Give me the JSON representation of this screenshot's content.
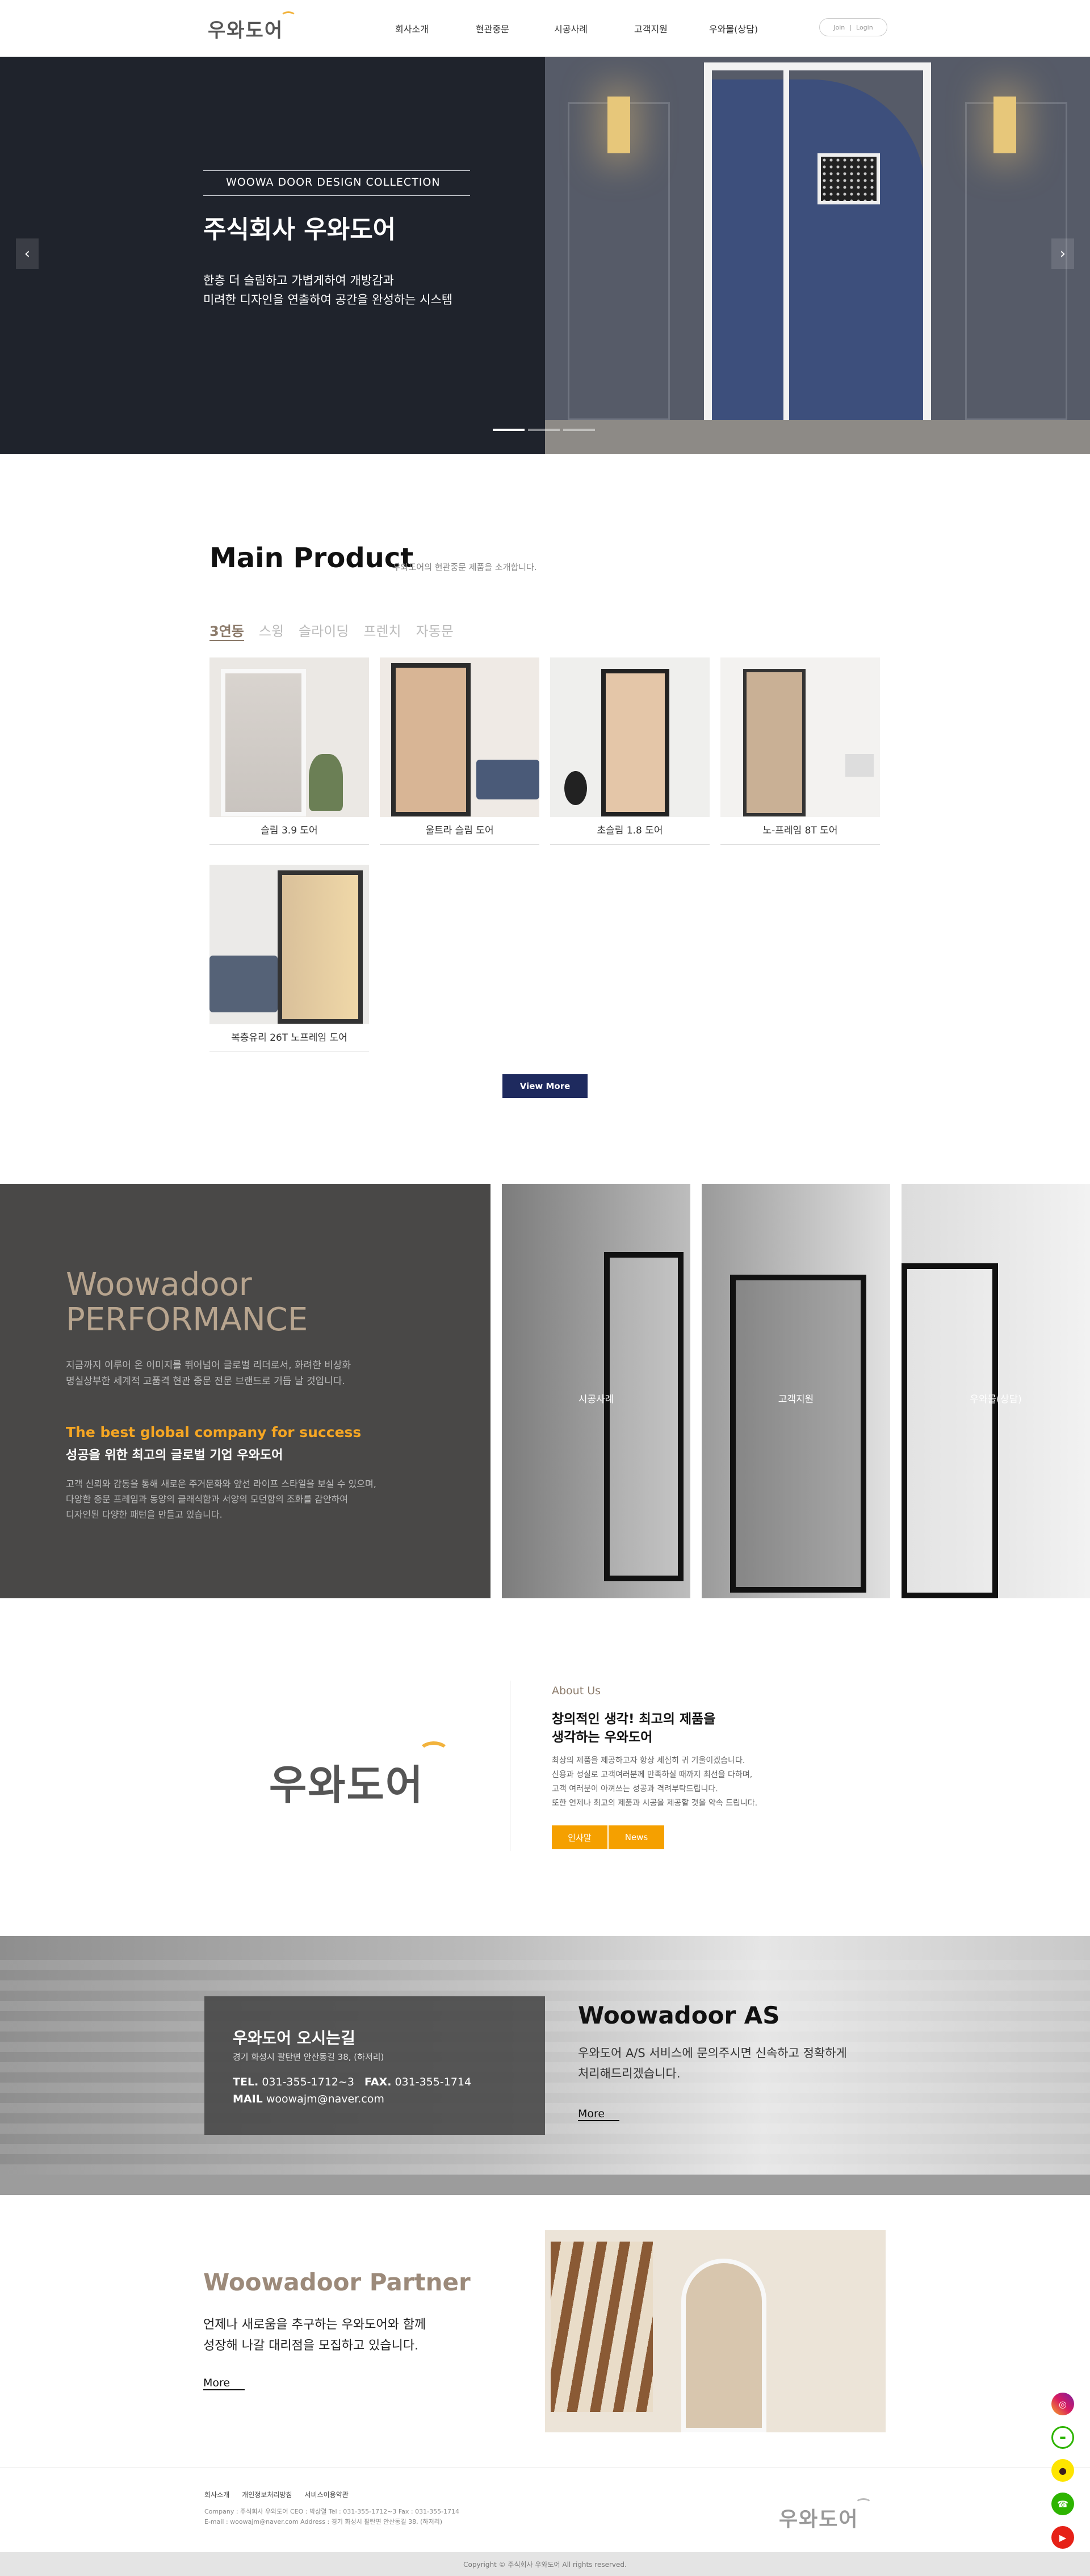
{
  "header": {
    "logo": "우와도어",
    "nav": [
      "회사소개",
      "현관중문",
      "시공사례",
      "고객지원",
      "우와몰(상담)"
    ],
    "join": "Join",
    "login": "Login"
  },
  "hero": {
    "kicker": "WOOWA DOOR DESIGN COLLECTION",
    "title": "주식회사 우와도어",
    "line1": "한층 더 슬림하고 가볍게하여 개방감과",
    "line2": "미려한 디자인을 연출하여 공간을 완성하는 시스템",
    "prev": "‹",
    "next": "›",
    "slides": 3,
    "active_slide": 0
  },
  "product": {
    "title": "Main Product",
    "subtitle": "우와도어의 현관중문 제품을 소개합니다.",
    "tabs": [
      "3연동",
      "스윙",
      "슬라이딩",
      "프렌치",
      "자동문"
    ],
    "active_tab": 0,
    "items": [
      "슬림 3.9 도어",
      "울트라 슬림 도어",
      "초슬림 1.8 도어",
      "노-프레임 8T 도어",
      "복층유리 26T 노프레임 도어"
    ],
    "view_more": "View More"
  },
  "performance": {
    "title1": "Woowadoor",
    "title2": "PERFORMANCE",
    "desc1": "지금까지 이루어 온 이미지를 뛰어넘어 글로벌 리더로서, 화려한 비상화",
    "desc2": "명실상부한 세계적 고품격 현관 중문 전문 브랜드로 거듭 날 것입니다.",
    "accent": "The best global company for success",
    "sub": "성공을 위한 최고의 글로벌 기업 우와도어",
    "p1": "고객 신뢰와 감동을 통해 새로운 주거문화와 앞선 라이프 스타일을 보실 수 있으며,",
    "p2": "다양한 중문 프레임과 동양의 클래식함과 서양의 모던함의 조화를 감안하여",
    "p3": "디자인된 다양한 패턴을 만들고 있습니다.",
    "panels": [
      "시공사례",
      "고객지원",
      "우와몰(상담)"
    ],
    "accent_color": "#f5a623"
  },
  "about": {
    "logo": "우와도어",
    "label": "About Us",
    "h1": "창의적인 생각! 최고의 제품을",
    "h2": "생각하는 우와도어",
    "p1": "최상의 제품을 제공하고자 항상 세심히 귀 기울이겠습니다.",
    "p2": "신용과 성실로 고객여러분께 만족하실 때까지 최선을 다하며,",
    "p3": "고객 여러분이 아껴쓰는 성공과 격려부탁드립니다.",
    "p4": "또한 언제나 최고의 제품과 시공을 제공할 것을 약속 드립니다.",
    "btn1": "인사말",
    "btn2": "News",
    "btn_color": "#f5a000"
  },
  "as": {
    "box_title": "우와도어 오시는길",
    "address": "경기 화성시 팔탄면 안산동길 38, (하저리)",
    "tel_label": "TEL.",
    "tel": "031-355-1712~3",
    "fax_label": "FAX.",
    "fax": "031-355-1714",
    "mail_label": "MAIL",
    "mail": "woowajm@naver.com",
    "title": "Woowadoor AS",
    "d1": "우와도어 A/S 서비스에 문의주시면 신속하고 정확하게",
    "d2": "처리해드리겠습니다.",
    "more": "More"
  },
  "partner": {
    "title": "Woowadoor Partner",
    "d1": "언제나 새로움을 추구하는 우와도어와 함께",
    "d2": "성장해 나갈 대리점을 모집하고 있습니다.",
    "more": "More"
  },
  "footer": {
    "links": [
      "회사소개",
      "개인정보처리방침",
      "서비스이용약관"
    ],
    "company": "Company : 주식회사 우와도어   CEO : 박상렬   Tel : 031-355-1712~3   Fax : 031-355-1714",
    "contact": "E-mail : woowajm@naver.com   Address : 경기 화성시 팔탄면 안산동길 38, (하저리)",
    "logo": "우와도어",
    "copyright": "Copyright © 주식회사 우와도어 All rights reserved."
  },
  "side_icons": [
    "instagram-icon",
    "blog-icon",
    "kakaotalk-icon",
    "talk-icon",
    "youtube-icon"
  ]
}
